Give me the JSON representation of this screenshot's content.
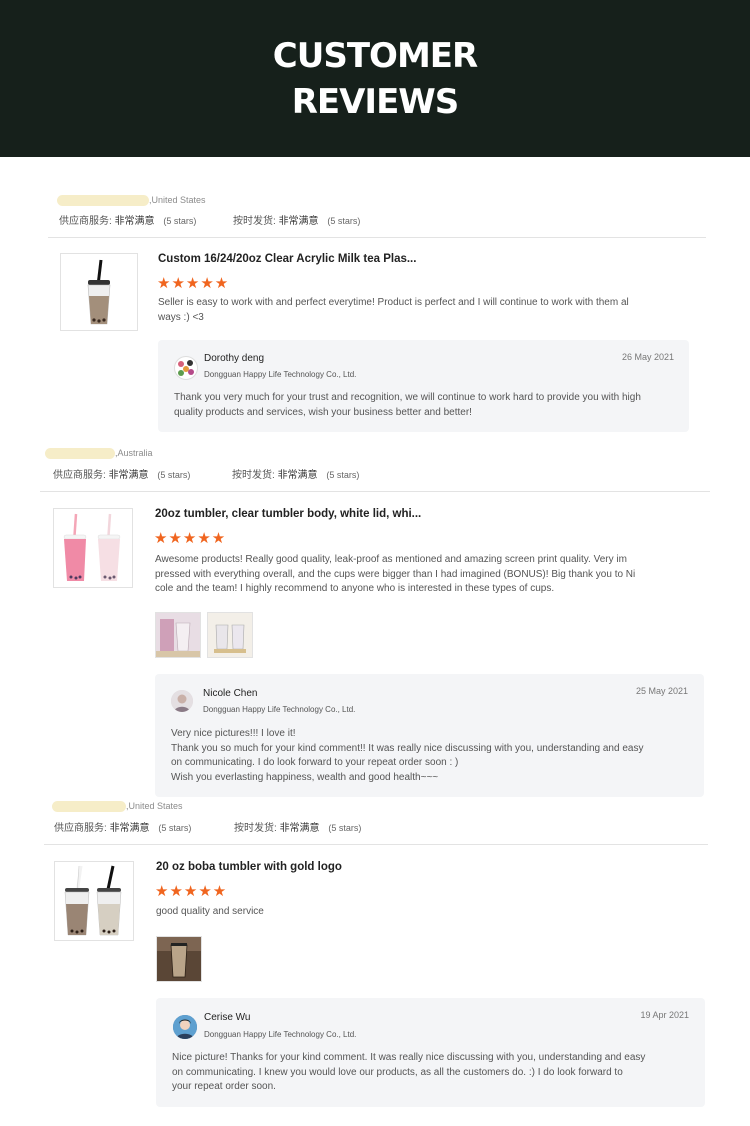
{
  "header": {
    "line1": "CUSTOMER",
    "line2": "REVIEWS"
  },
  "labels": {
    "supplier_service": "供应商服务:",
    "on_time_delivery": "按时发货:",
    "very_satisfied": "非常满意",
    "five_stars": "(5 stars)",
    "star_glyphs": "★★★★★"
  },
  "reviews": [
    {
      "country": ",United States",
      "product_title": "Custom 16/24/20oz Clear Acrylic Milk tea Plas...",
      "rating": 5,
      "comment_lines": [
        "Seller is easy to work with and perfect everytime! Product is perfect and I will continue to work with them al",
        "ways :) <3"
      ],
      "reply": {
        "name": "Dorothy deng",
        "company": "Dongguan Happy Life Technology Co., Ltd.",
        "date": "26 May 2021",
        "text_lines": [
          "Thank you very much for your trust and recognition, we will continue to work hard to provide you with high",
          "quality products and services, wish your business better and better!"
        ]
      }
    },
    {
      "country": ",Australia",
      "product_title": "20oz tumbler, clear tumbler body, white lid, whi...",
      "rating": 5,
      "comment_lines": [
        "Awesome products! Really good quality, leak-proof as mentioned and amazing screen print quality. Very im",
        "pressed with everything overall, and the cups were bigger than I had imagined (BONUS)! Big thank you to Ni",
        "cole and the team! I highly recommend to anyone who is interested in these types of cups."
      ],
      "reply": {
        "name": "Nicole Chen",
        "company": "Dongguan Happy Life Technology Co., Ltd.",
        "date": "25 May 2021",
        "text_lines": [
          "Very nice pictures!!! I love it!",
          "Thank you so much for your kind comment!! It was really nice discussing with you, understanding and easy",
          "on communicating.  I do look forward to your repeat order soon : )",
          "Wish you everlasting happiness, wealth and good health~~~"
        ]
      }
    },
    {
      "country": ",United States",
      "product_title": "20 oz boba tumbler with gold logo",
      "rating": 5,
      "comment_lines": [
        "good quality and service"
      ],
      "reply": {
        "name": "Cerise Wu",
        "company": "Dongguan Happy Life Technology Co., Ltd.",
        "date": "19 Apr 2021",
        "text_lines": [
          "Nice picture! Thanks for your kind comment. It was really nice discussing with you, understanding and easy",
          "on communicating. I knew you would love our products, as all the customers do. :)  I do look forward to",
          "your repeat order soon."
        ]
      }
    }
  ]
}
